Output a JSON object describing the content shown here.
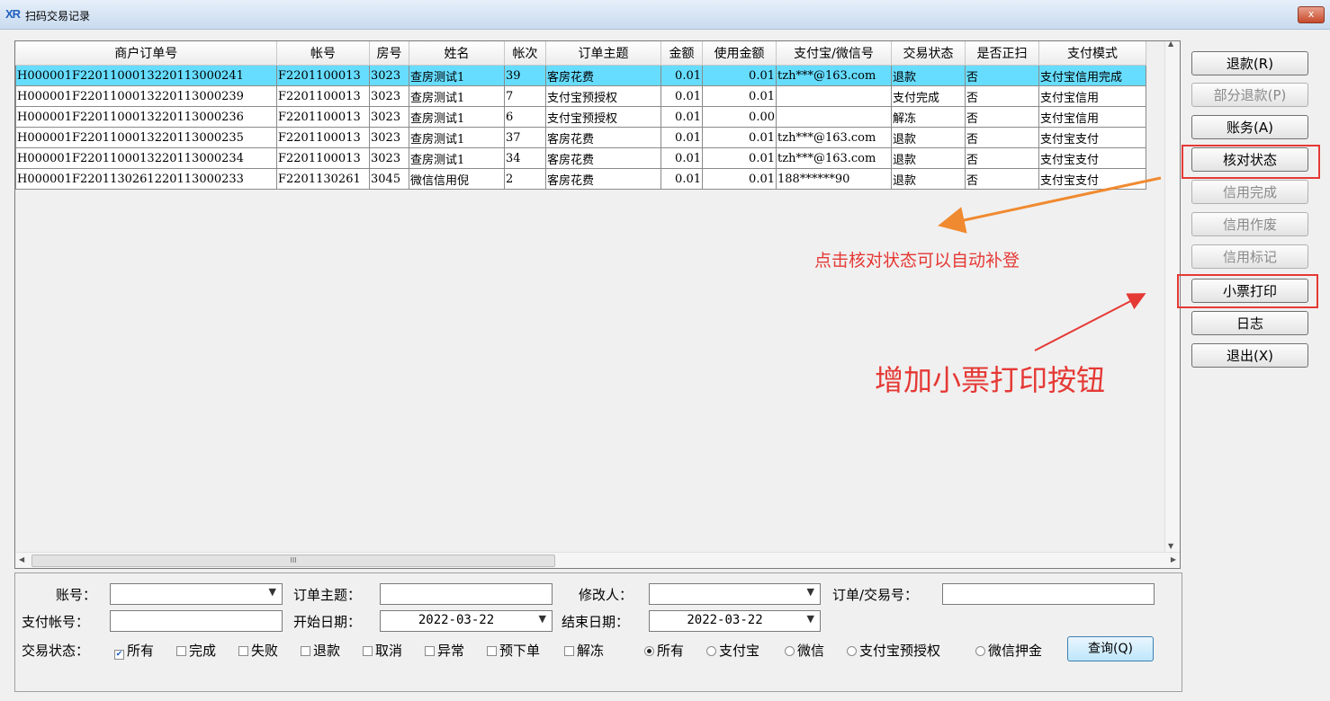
{
  "window": {
    "title": "扫码交易记录",
    "app_icon": "XR",
    "close_label": "x"
  },
  "table": {
    "columns": [
      "商户订单号",
      "帐号",
      "房号",
      "姓名",
      "帐次",
      "订单主题",
      "金额",
      "使用金额",
      "支付宝/微信号",
      "交易状态",
      "是否正扫",
      "支付模式"
    ],
    "rows": [
      [
        "H000001F2201100013220113000241",
        "F2201100013",
        "3023",
        "查房测试1",
        "39",
        "客房花费",
        "0.01",
        "0.01",
        "tzh***@163.com",
        "退款",
        "否",
        "支付宝信用完成"
      ],
      [
        "H000001F2201100013220113000239",
        "F2201100013",
        "3023",
        "查房测试1",
        "7",
        "支付宝预授权",
        "0.01",
        "0.01",
        "",
        "支付完成",
        "否",
        "支付宝信用"
      ],
      [
        "H000001F2201100013220113000236",
        "F2201100013",
        "3023",
        "查房测试1",
        "6",
        "支付宝预授权",
        "0.01",
        "0.00",
        "",
        "解冻",
        "否",
        "支付宝信用"
      ],
      [
        "H000001F2201100013220113000235",
        "F2201100013",
        "3023",
        "查房测试1",
        "37",
        "客房花费",
        "0.01",
        "0.01",
        "tzh***@163.com",
        "退款",
        "否",
        "支付宝支付"
      ],
      [
        "H000001F2201100013220113000234",
        "F2201100013",
        "3023",
        "查房测试1",
        "34",
        "客房花费",
        "0.01",
        "0.01",
        "tzh***@163.com",
        "退款",
        "否",
        "支付宝支付"
      ],
      [
        "H000001F2201130261220113000233",
        "F2201130261",
        "3045",
        "微信信用倪",
        "2",
        "客房花费",
        "0.01",
        "0.01",
        "188******90",
        "退款",
        "否",
        "支付宝支付"
      ]
    ],
    "selected_row": 0,
    "hscroll_mark": "III"
  },
  "buttons": {
    "refund": "退款(R)",
    "partial_refund": "部分退款(P)",
    "account": "账务(A)",
    "check_status": "核对状态",
    "credit_complete": "信用完成",
    "credit_void": "信用作废",
    "credit_mark": "信用标记",
    "receipt_print": "小票打印",
    "log": "日志",
    "exit": "退出(X)"
  },
  "filters": {
    "account_label": "账号：",
    "order_subject_label": "订单主题：",
    "modifier_label": "修改人：",
    "order_txn_label": "订单/交易号：",
    "pay_account_label": "支付帐号：",
    "start_date_label": "开始日期：",
    "start_date": "2022-03-22",
    "end_date_label": "结束日期：",
    "end_date": "2022-03-22",
    "status_label": "交易状态：",
    "status_options": [
      "所有",
      "完成",
      "失败",
      "退款",
      "取消",
      "异常",
      "预下单",
      "解冻"
    ],
    "pay_options": [
      "所有",
      "支付宝",
      "微信",
      "支付宝预授权",
      "微信押金"
    ],
    "query": "查询(Q)"
  },
  "annotations": {
    "hint": "点击核对状态可以自动补登",
    "headline": "增加小票打印按钮",
    "color": "#e53935"
  }
}
